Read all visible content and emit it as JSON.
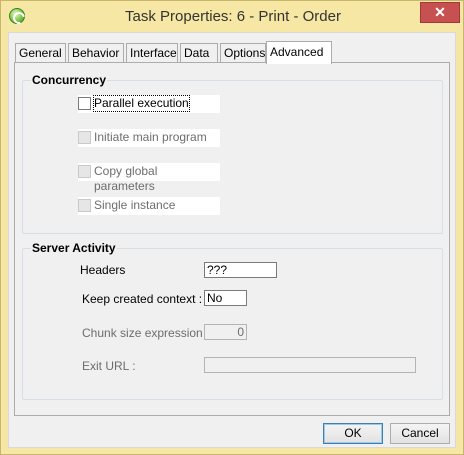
{
  "window": {
    "title": "Task Properties: 6 -   Print - Order",
    "close_glyph": "✕"
  },
  "tabs": [
    {
      "label": "General"
    },
    {
      "label": "Behavior"
    },
    {
      "label": "Interface"
    },
    {
      "label": "Data"
    },
    {
      "label": "Options"
    },
    {
      "label": "Advanced",
      "active": true
    }
  ],
  "concurrency": {
    "title": "Concurrency",
    "options": [
      {
        "label": "Parallel execution",
        "checked": false,
        "enabled": true
      },
      {
        "label": "Initiate main program",
        "checked": false,
        "enabled": false
      },
      {
        "label": "Copy global parameters",
        "checked": false,
        "enabled": false
      },
      {
        "label": "Single instance",
        "checked": false,
        "enabled": false
      }
    ]
  },
  "server_activity": {
    "title": "Server Activity",
    "headers_label": "Headers",
    "headers_value": "???",
    "keep_context_label": "Keep created context :",
    "keep_context_value": "No",
    "chunk_size_label": "Chunk size expression :",
    "chunk_size_value": "0",
    "exit_url_label": "Exit URL :",
    "exit_url_value": ""
  },
  "buttons": {
    "ok": "OK",
    "cancel": "Cancel"
  },
  "colors": {
    "title_bar": "#f6e8a4",
    "close_button": "#c75050"
  }
}
